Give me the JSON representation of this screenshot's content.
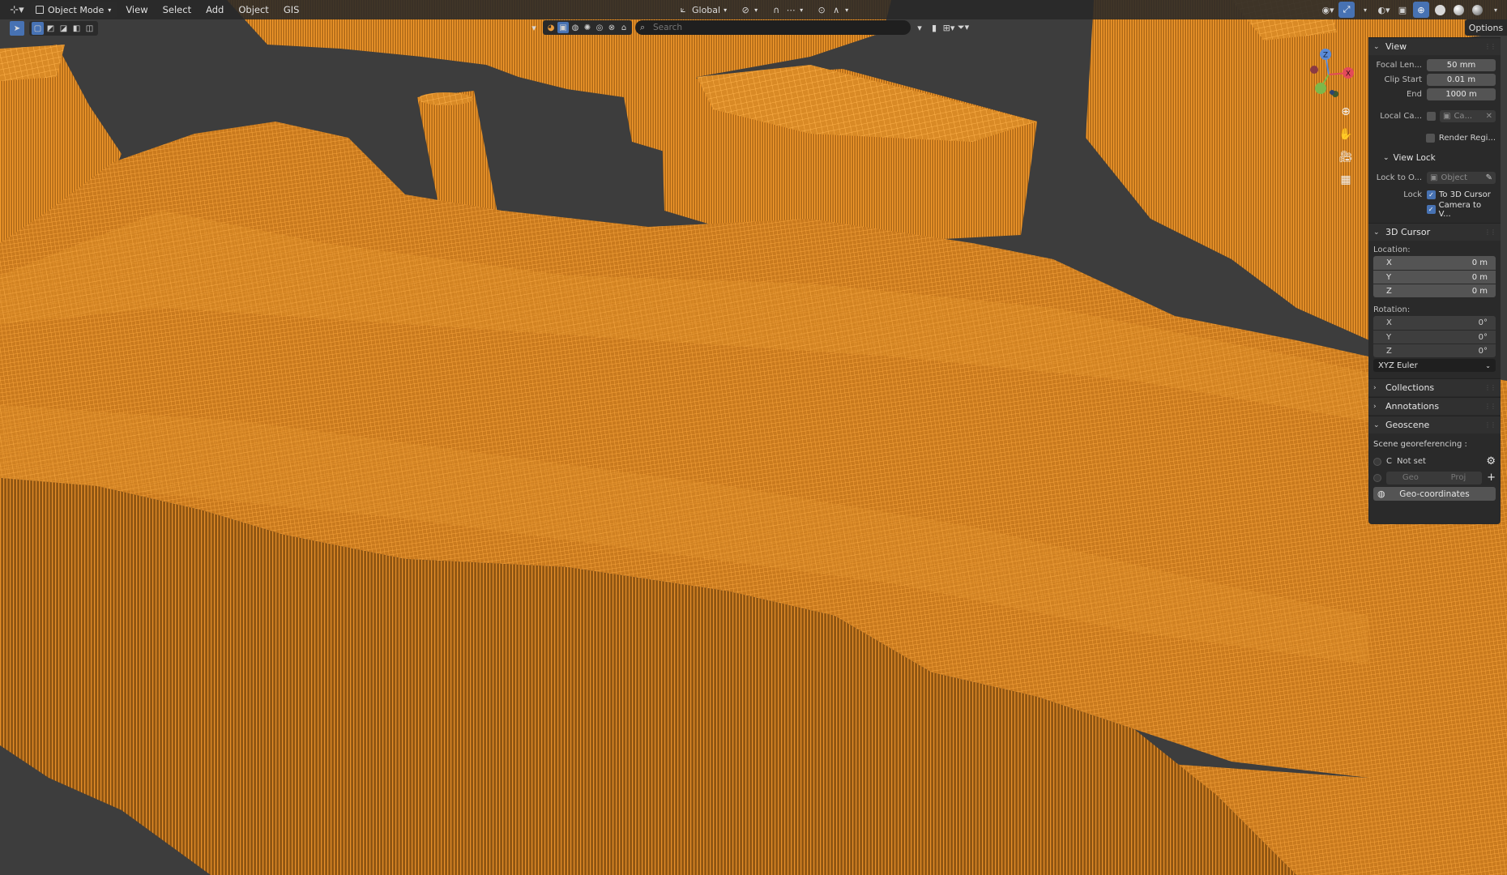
{
  "header": {
    "mode": "Object Mode",
    "menus": [
      "View",
      "Select",
      "Add",
      "Object",
      "GIS"
    ],
    "transform_orientation": "Global"
  },
  "search": {
    "placeholder": "Search"
  },
  "options_label": "Options",
  "gizmo": {
    "x": "X",
    "y": "Y",
    "z": "Z"
  },
  "sidebar": {
    "view": {
      "title": "View",
      "focal_length_label": "Focal Len...",
      "focal_length_value": "50 mm",
      "clip_start_label": "Clip Start",
      "clip_start_value": "0.01 m",
      "clip_end_label": "End",
      "clip_end_value": "1000 m",
      "local_camera_label": "Local Ca...",
      "local_camera_value": "Ca...",
      "render_region_label": "Render Regi...",
      "view_lock_title": "View Lock",
      "lock_to_object_label": "Lock to O...",
      "lock_to_object_placeholder": "Object",
      "lock_label": "Lock",
      "to_3d_cursor_label": "To 3D Cursor",
      "camera_to_view_label": "Camera to V..."
    },
    "cursor": {
      "title": "3D Cursor",
      "location_label": "Location:",
      "location": [
        {
          "axis": "X",
          "value": "0 m"
        },
        {
          "axis": "Y",
          "value": "0 m"
        },
        {
          "axis": "Z",
          "value": "0 m"
        }
      ],
      "rotation_label": "Rotation:",
      "rotation": [
        {
          "axis": "X",
          "value": "0°"
        },
        {
          "axis": "Y",
          "value": "0°"
        },
        {
          "axis": "Z",
          "value": "0°"
        }
      ],
      "rotation_mode": "XYZ Euler"
    },
    "collections_title": "Collections",
    "annotations_title": "Annotations",
    "geoscene": {
      "title": "Geoscene",
      "georef_label": "Scene georeferencing :",
      "crs_code": "C",
      "crs_status": "Not set",
      "geo_label": "Geo",
      "proj_label": "Proj",
      "geo_coordinates_label": "Geo-coordinates"
    }
  },
  "colors": {
    "accent": "#4772b3",
    "wireframe": "#f0962a",
    "background": "#3d3d3d",
    "panel": "#2a2a2a"
  }
}
